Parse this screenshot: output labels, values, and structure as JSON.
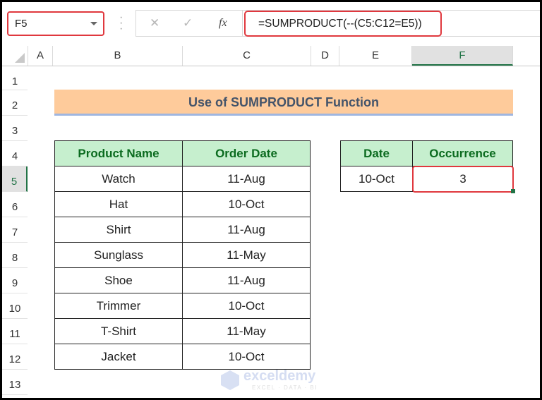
{
  "formula_bar": {
    "name_box": "F5",
    "cancel_icon": "✕",
    "enter_icon": "✓",
    "fx_label": "fx",
    "formula": "=SUMPRODUCT(--(C5:C12=E5))"
  },
  "columns": [
    "A",
    "B",
    "C",
    "D",
    "E",
    "F"
  ],
  "selected_column": "F",
  "rows": [
    "1",
    "2",
    "3",
    "4",
    "5",
    "6",
    "7",
    "8",
    "9",
    "10",
    "11",
    "12",
    "13"
  ],
  "selected_row": "5",
  "title": "Use of SUMPRODUCT Function",
  "product_table": {
    "headers": [
      "Product Name",
      "Order Date"
    ],
    "rows": [
      [
        "Watch",
        "11-Aug"
      ],
      [
        "Hat",
        "10-Oct"
      ],
      [
        "Shirt",
        "11-Aug"
      ],
      [
        "Sunglass",
        "11-May"
      ],
      [
        "Shoe",
        "11-Aug"
      ],
      [
        "Trimmer",
        "10-Oct"
      ],
      [
        "T-Shirt",
        "11-May"
      ],
      [
        "Jacket",
        "10-Oct"
      ]
    ]
  },
  "result_table": {
    "headers": [
      "Date",
      "Occurrence"
    ],
    "date": "10-Oct",
    "occurrence": "3"
  },
  "watermark": {
    "name": "exceldemy",
    "tagline": "EXCEL · DATA · BI"
  },
  "colors": {
    "highlight_red": "#e0383e",
    "header_green_bg": "#c6efce",
    "header_green_text": "#0b6b1f",
    "title_bg": "#fecb9b",
    "excel_green": "#217346"
  }
}
